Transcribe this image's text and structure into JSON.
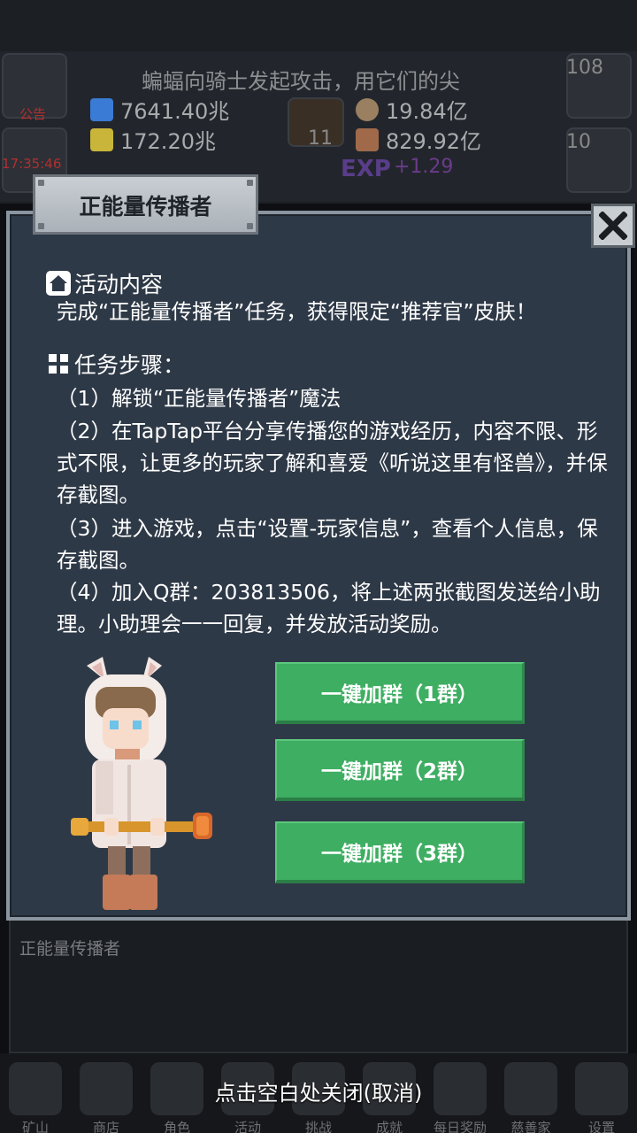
{
  "background": {
    "notice_text": "蝙蝠向骑士发起攻击，用它们的尖",
    "notice_label": "公告",
    "time_label": "17:35:46",
    "resources": [
      {
        "name": "potion-blue",
        "value": "7641.40兆",
        "color": "#3a7bd5"
      },
      {
        "name": "potion-yellow",
        "value": "172.20兆",
        "color": "#c9b53a"
      },
      {
        "name": "coin",
        "value": "19.84亿",
        "color": "#9a8060"
      },
      {
        "name": "meat",
        "value": "829.92亿",
        "color": "#a06a4a"
      }
    ],
    "book_count": "11",
    "right_count_1": "108",
    "right_count_2": "10",
    "exp_label": "EXP",
    "exp_value": "+1.29"
  },
  "dialog": {
    "title": "正能量传播者",
    "section1_title": "活动内容",
    "section1_text": "完成“正能量传播者”任务，获得限定“推荐官”皮肤！",
    "section2_title": "任务步骤：",
    "steps": [
      "（1）解锁“正能量传播者”魔法",
      "（2）在TapTap平台分享传播您的游戏经历，内容不限、形式不限，让更多的玩家了解和喜爱《听说这里有怪兽》，并保存截图。",
      "（3）进入游戏，点击“设置-玩家信息”，查看个人信息，保存截图。",
      "（4）加入Q群：203813506，将上述两张截图发送给小助理。小助理会一一回复，并发放活动奖励。"
    ],
    "buttons": [
      "一键加群（1群）",
      "一键加群（2群）",
      "一键加群（3群）"
    ]
  },
  "under_dialog_label": "正能量传播者",
  "close_hint": "点击空白处关闭(取消)",
  "bottom_tabs": [
    "矿山",
    "商店",
    "角色",
    "活动",
    "挑战",
    "成就",
    "每日奖励",
    "慈善家",
    "设置"
  ]
}
